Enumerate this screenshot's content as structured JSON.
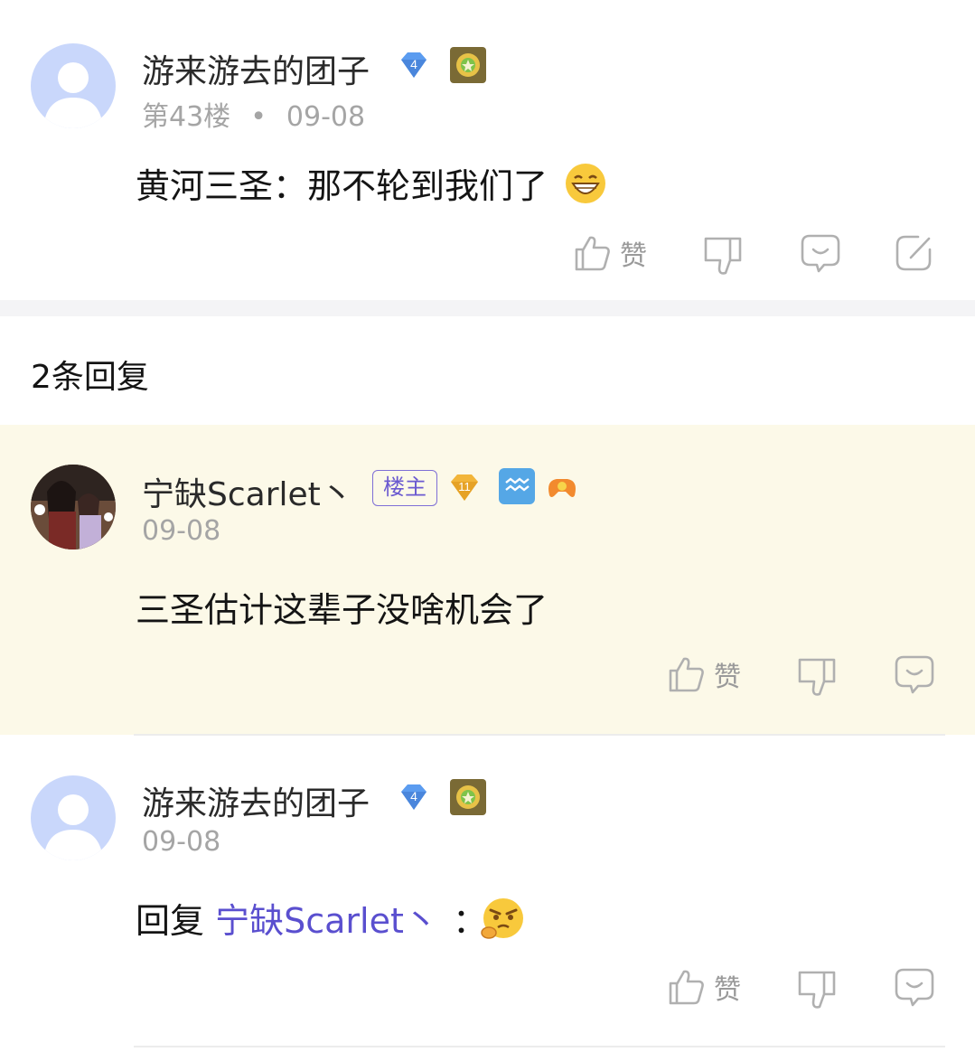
{
  "main_post": {
    "username": "游来游去的团子",
    "level": "4",
    "floor": "第43楼",
    "separator": "•",
    "date": "09-08",
    "content": "黄河三圣：那不轮到我们了",
    "emoji": "grin-emoji",
    "actions": {
      "like_label": "赞"
    }
  },
  "replies_header": "2条回复",
  "replies": [
    {
      "username": "宁缺Scarlet丶",
      "host_tag": "楼主",
      "level": "11",
      "date": "09-08",
      "content": "三圣估计这辈子没啥机会了",
      "actions": {
        "like_label": "赞"
      },
      "highlighted": true
    },
    {
      "username": "游来游去的团子",
      "level": "4",
      "date": "09-08",
      "reply_prefix": "回复",
      "reply_to": "宁缺Scarlet丶",
      "reply_colon": "：",
      "emoji": "thinking-angry-emoji",
      "actions": {
        "like_label": "赞"
      }
    }
  ],
  "colors": {
    "background": "#ffffff",
    "highlight_bg": "#fcf9e8",
    "link": "#5a4fcf",
    "meta_text": "#a5a5a5",
    "icon": "#b0b0b0",
    "level_diamond_blue": "#5b9cf0",
    "level_diamond_gold": "#f2b53a"
  }
}
